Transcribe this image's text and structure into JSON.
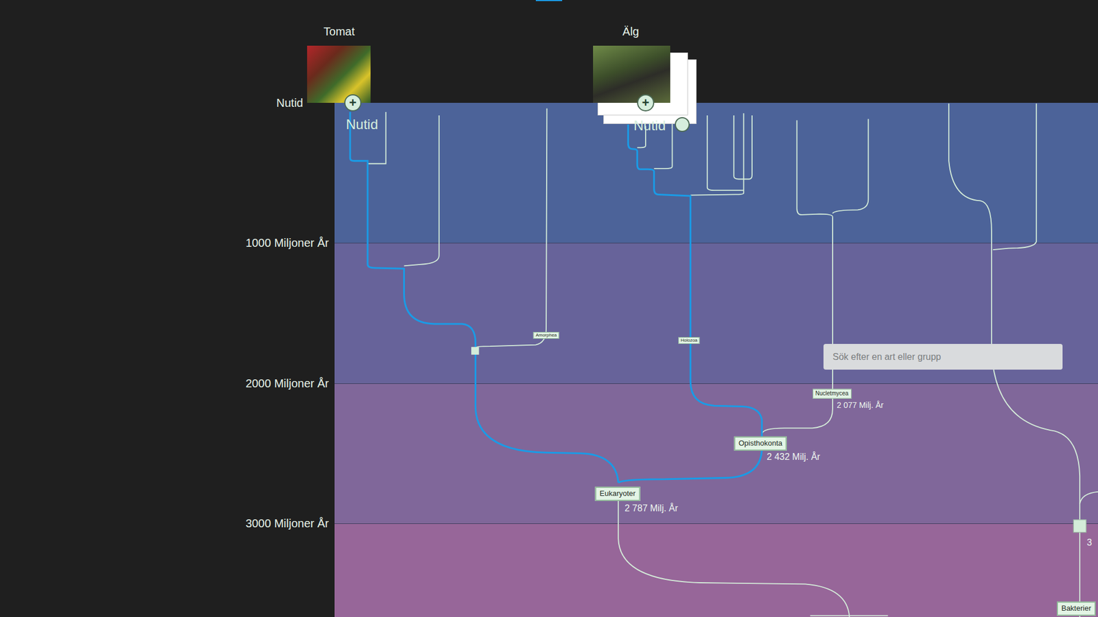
{
  "species": [
    {
      "name": "Tomat",
      "plus": "+",
      "time": "Nutid"
    },
    {
      "name": "Älg",
      "plus": "+",
      "time": "Nutid"
    }
  ],
  "axis": {
    "labels": [
      "Nutid",
      "1000 Miljoner År",
      "2000 Miljoner År",
      "3000 Miljoner År"
    ]
  },
  "nodes": [
    {
      "label": "Amorphea",
      "kind": "minor"
    },
    {
      "label": "Holozoa",
      "kind": "minor"
    },
    {
      "label": "Nucletmycea",
      "kind": "medium",
      "age": "2 077 Milj. År"
    },
    {
      "label": "Opisthokonta",
      "kind": "major",
      "age": "2 432 Milj. År"
    },
    {
      "label": "Eukaryoter",
      "kind": "major",
      "age": "2 787 Milj. År"
    },
    {
      "label": "Bakterier",
      "kind": "major",
      "age": "3"
    }
  ],
  "search": {
    "placeholder": "Sök efter en art eller grupp"
  }
}
